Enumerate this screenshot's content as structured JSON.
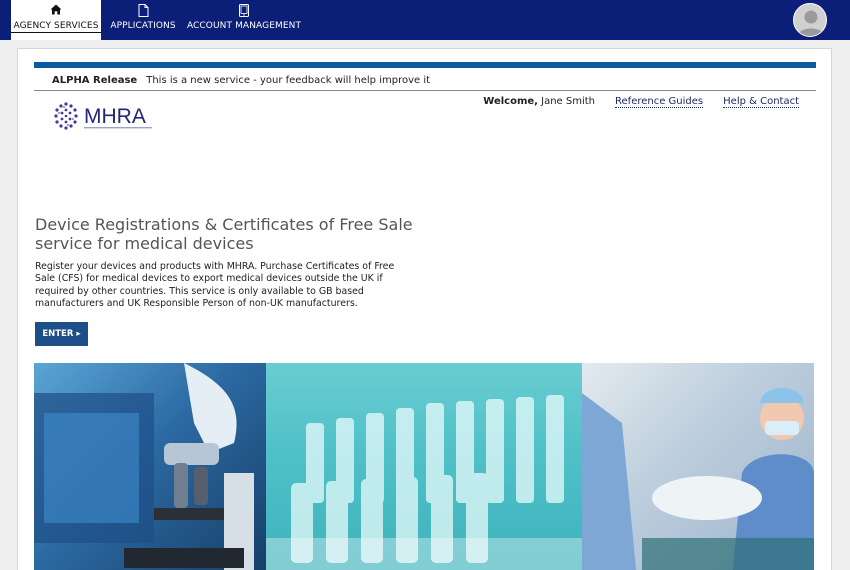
{
  "nav": {
    "items": [
      {
        "label": "AGENCY SERVICES",
        "icon": "home-icon",
        "active": true
      },
      {
        "label": "APPLICATIONS",
        "icon": "document-icon",
        "active": false
      },
      {
        "label": "ACCOUNT MANAGEMENT",
        "icon": "tablet-icon",
        "active": false
      }
    ],
    "avatar_icon": "user-avatar-icon"
  },
  "banner": {
    "tag": "ALPHA Release",
    "message": "This is a new service - your feedback will help improve it"
  },
  "header": {
    "logo_text": "MHRA",
    "welcome_label": "Welcome,",
    "user_name": "Jane Smith",
    "links": [
      "Reference Guides",
      "Help & Contact"
    ]
  },
  "main": {
    "title": "Device Registrations & Certificates of Free Sale service for medical devices",
    "description": "Register your devices and products with MHRA. Purchase Certificates of Free Sale (CFS) for medical devices to export medical devices outside the UK if required by other countries. This service is only available to GB based manufacturers and UK Responsible Person of non-UK manufacturers.",
    "enter_label": "ENTER ▸"
  },
  "colors": {
    "nav_bg": "#0b1f78",
    "accent_bar": "#0c5a9f",
    "button_bg": "#1d4e8a"
  }
}
